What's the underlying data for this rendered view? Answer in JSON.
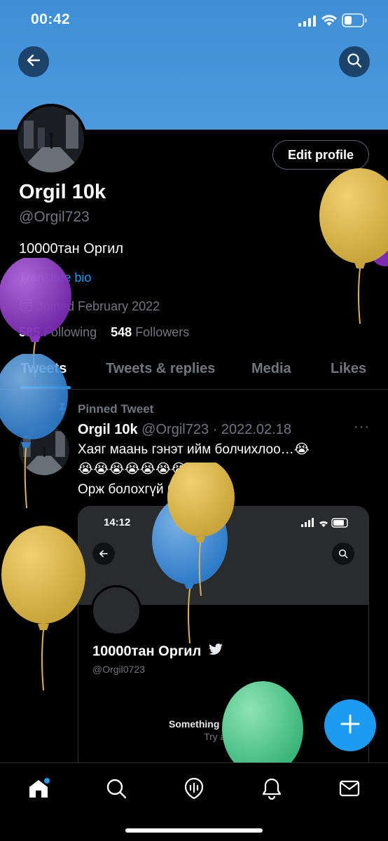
{
  "status_bar": {
    "time": "00:42"
  },
  "profile": {
    "name": "Orgil 10k",
    "handle": "@Orgil723",
    "bio": "10000тан Оргил",
    "translate_label": "Translate bio",
    "joined": "Joined February 2022",
    "following_count": "585",
    "following_label": "Following",
    "followers_count": "548",
    "followers_label": "Followers",
    "edit_label": "Edit profile"
  },
  "tabs": [
    {
      "label": "Tweets",
      "active": true
    },
    {
      "label": "Tweets & replies"
    },
    {
      "label": "Media"
    },
    {
      "label": "Likes"
    }
  ],
  "pinned_tweet": {
    "pinned_label": "Pinned Tweet",
    "author": "Orgil 10k",
    "meta": "@Orgil723 · 2022.02.18",
    "line1": "Хаяг маань гэнэт ийм болчихлоо…😭",
    "line2": "😭😭😭😭😭😭😭",
    "line3": "Орж болохгүй байна",
    "more": "···",
    "card": {
      "time": "14:12",
      "name": "10000тан Оргил",
      "handle": "@Orgil0723",
      "error": "Something went wrong.",
      "retry": "Try again"
    }
  },
  "icons": {
    "back": "back-arrow-icon",
    "search": "search-icon",
    "compose": "compose-icon",
    "nav": [
      "home-icon",
      "search-icon",
      "spaces-icon",
      "notifications-icon",
      "messages-icon"
    ]
  },
  "colors": {
    "accent": "#1d9bf0",
    "banner": "#4b9ae0",
    "background": "#000000",
    "muted": "#71767b"
  }
}
